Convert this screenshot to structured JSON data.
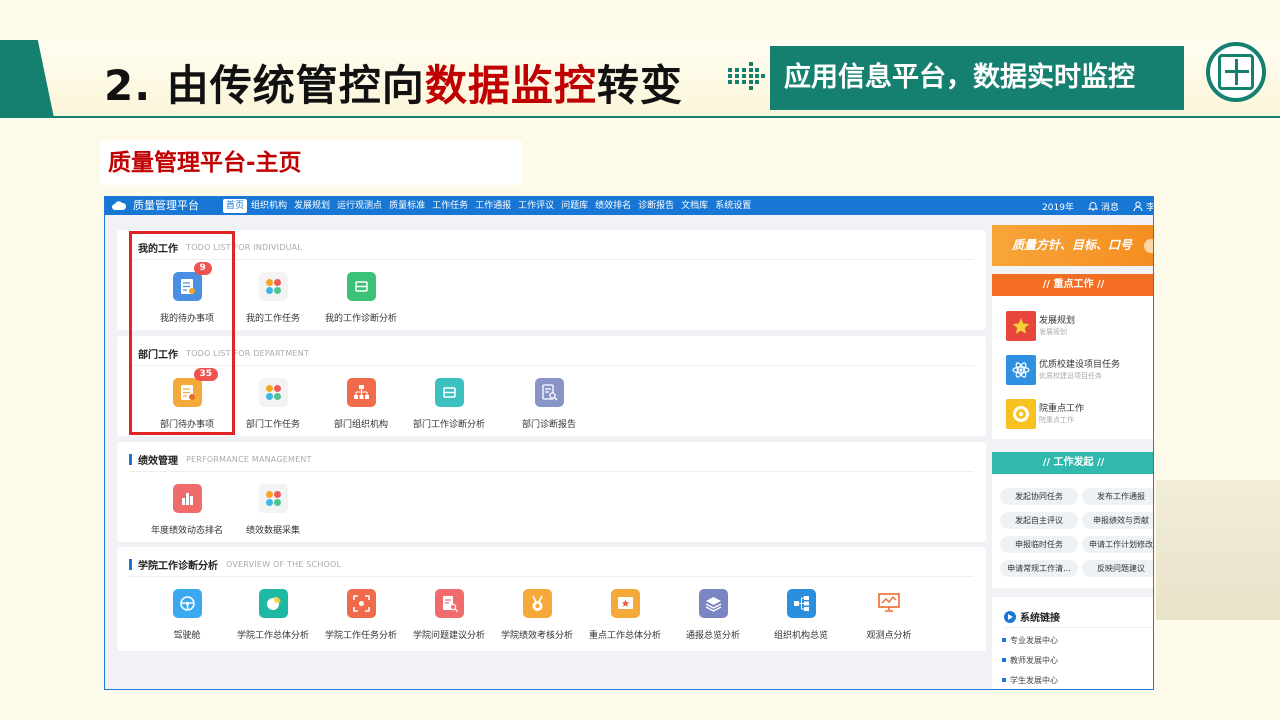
{
  "slide": {
    "title_plain": "2. 由传统管控向",
    "title_highlight": "数据监控",
    "title_suffix": "转变",
    "callout": "应用信息平台，数据实时监控",
    "sub_label": "质量管理平台-主页"
  },
  "app": {
    "name": "质量管理平台",
    "nav": [
      "首页",
      "组织机构",
      "发展规划",
      "运行观测点",
      "质量标准",
      "工作任务",
      "工作通报",
      "工作评议",
      "问题库",
      "绩效排名",
      "诊断报告",
      "文档库",
      "系统设置"
    ],
    "year": "2019年",
    "messages": "消息",
    "user": "李"
  },
  "panels": {
    "my_work": {
      "title": "我的工作",
      "subtitle": "TODO LIST FOR INDIVIDUAL",
      "tiles": [
        {
          "label": "我的待办事项",
          "badge": "9"
        },
        {
          "label": "我的工作任务"
        },
        {
          "label": "我的工作诊断分析"
        }
      ]
    },
    "dept_work": {
      "title": "部门工作",
      "subtitle": "TODO LIST FOR DEPARTMENT",
      "tiles": [
        {
          "label": "部门待办事项",
          "badge": "35"
        },
        {
          "label": "部门工作任务"
        },
        {
          "label": "部门组织机构"
        },
        {
          "label": "部门工作诊断分析"
        },
        {
          "label": "部门诊断报告"
        }
      ]
    },
    "performance": {
      "title": "绩效管理",
      "subtitle": "PERFORMANCE MANAGEMENT",
      "tiles": [
        {
          "label": "年度绩效动态排名"
        },
        {
          "label": "绩效数据采集"
        }
      ]
    },
    "school": {
      "title": "学院工作诊断分析",
      "subtitle": "OVERVIEW OF THE SCHOOL",
      "tiles": [
        {
          "label": "驾驶舱"
        },
        {
          "label": "学院工作总体分析"
        },
        {
          "label": "学院工作任务分析"
        },
        {
          "label": "学院问题建议分析"
        },
        {
          "label": "学院绩效考核分析"
        },
        {
          "label": "重点工作总体分析"
        },
        {
          "label": "通报总览分析"
        },
        {
          "label": "组织机构总览"
        },
        {
          "label": "观测点分析"
        }
      ]
    }
  },
  "right": {
    "banner": "质量方针、目标、口号",
    "key_work": {
      "header": "//    重点工作    //",
      "items": [
        {
          "title": "发展规划",
          "sub": "发展规划"
        },
        {
          "title": "优质校建设项目任务",
          "sub": "优质校建设项目任务"
        },
        {
          "title": "院重点工作",
          "sub": "院重点工作"
        }
      ]
    },
    "initiate": {
      "header": "//    工作发起    //",
      "pills": [
        "发起协同任务",
        "发布工作通报",
        "发起自主评议",
        "申报绩效与贡献",
        "申报临时任务",
        "申请工作计划修改",
        "申请常规工作清...",
        "反映问题建议"
      ]
    },
    "links": {
      "title": "系统链接",
      "items": [
        "专业发展中心",
        "教师发展中心",
        "学生发展中心"
      ]
    }
  },
  "colors": {
    "teal": "#15806f",
    "accent_red": "#c00000",
    "app_blue": "#1877d5",
    "orange": "#f58d1f",
    "teal_light": "#31b9ad"
  }
}
